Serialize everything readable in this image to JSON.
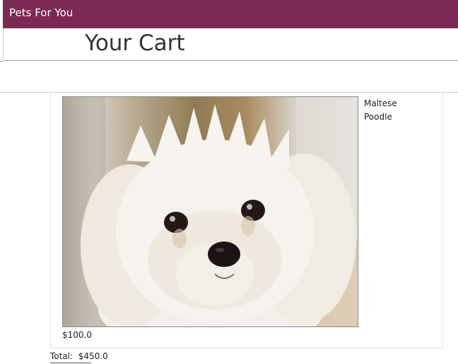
{
  "header": {
    "brand": "Pets For You",
    "brand_color": "#7b2a55"
  },
  "page": {
    "title": "Your Cart"
  },
  "cart": {
    "items": [
      {
        "image": "maltese-poodle-photo",
        "breed_lines": [
          "Maltese",
          "Poodle"
        ],
        "price": "$100.0"
      }
    ],
    "total_label": "Total:",
    "total_value": "$450.0"
  }
}
